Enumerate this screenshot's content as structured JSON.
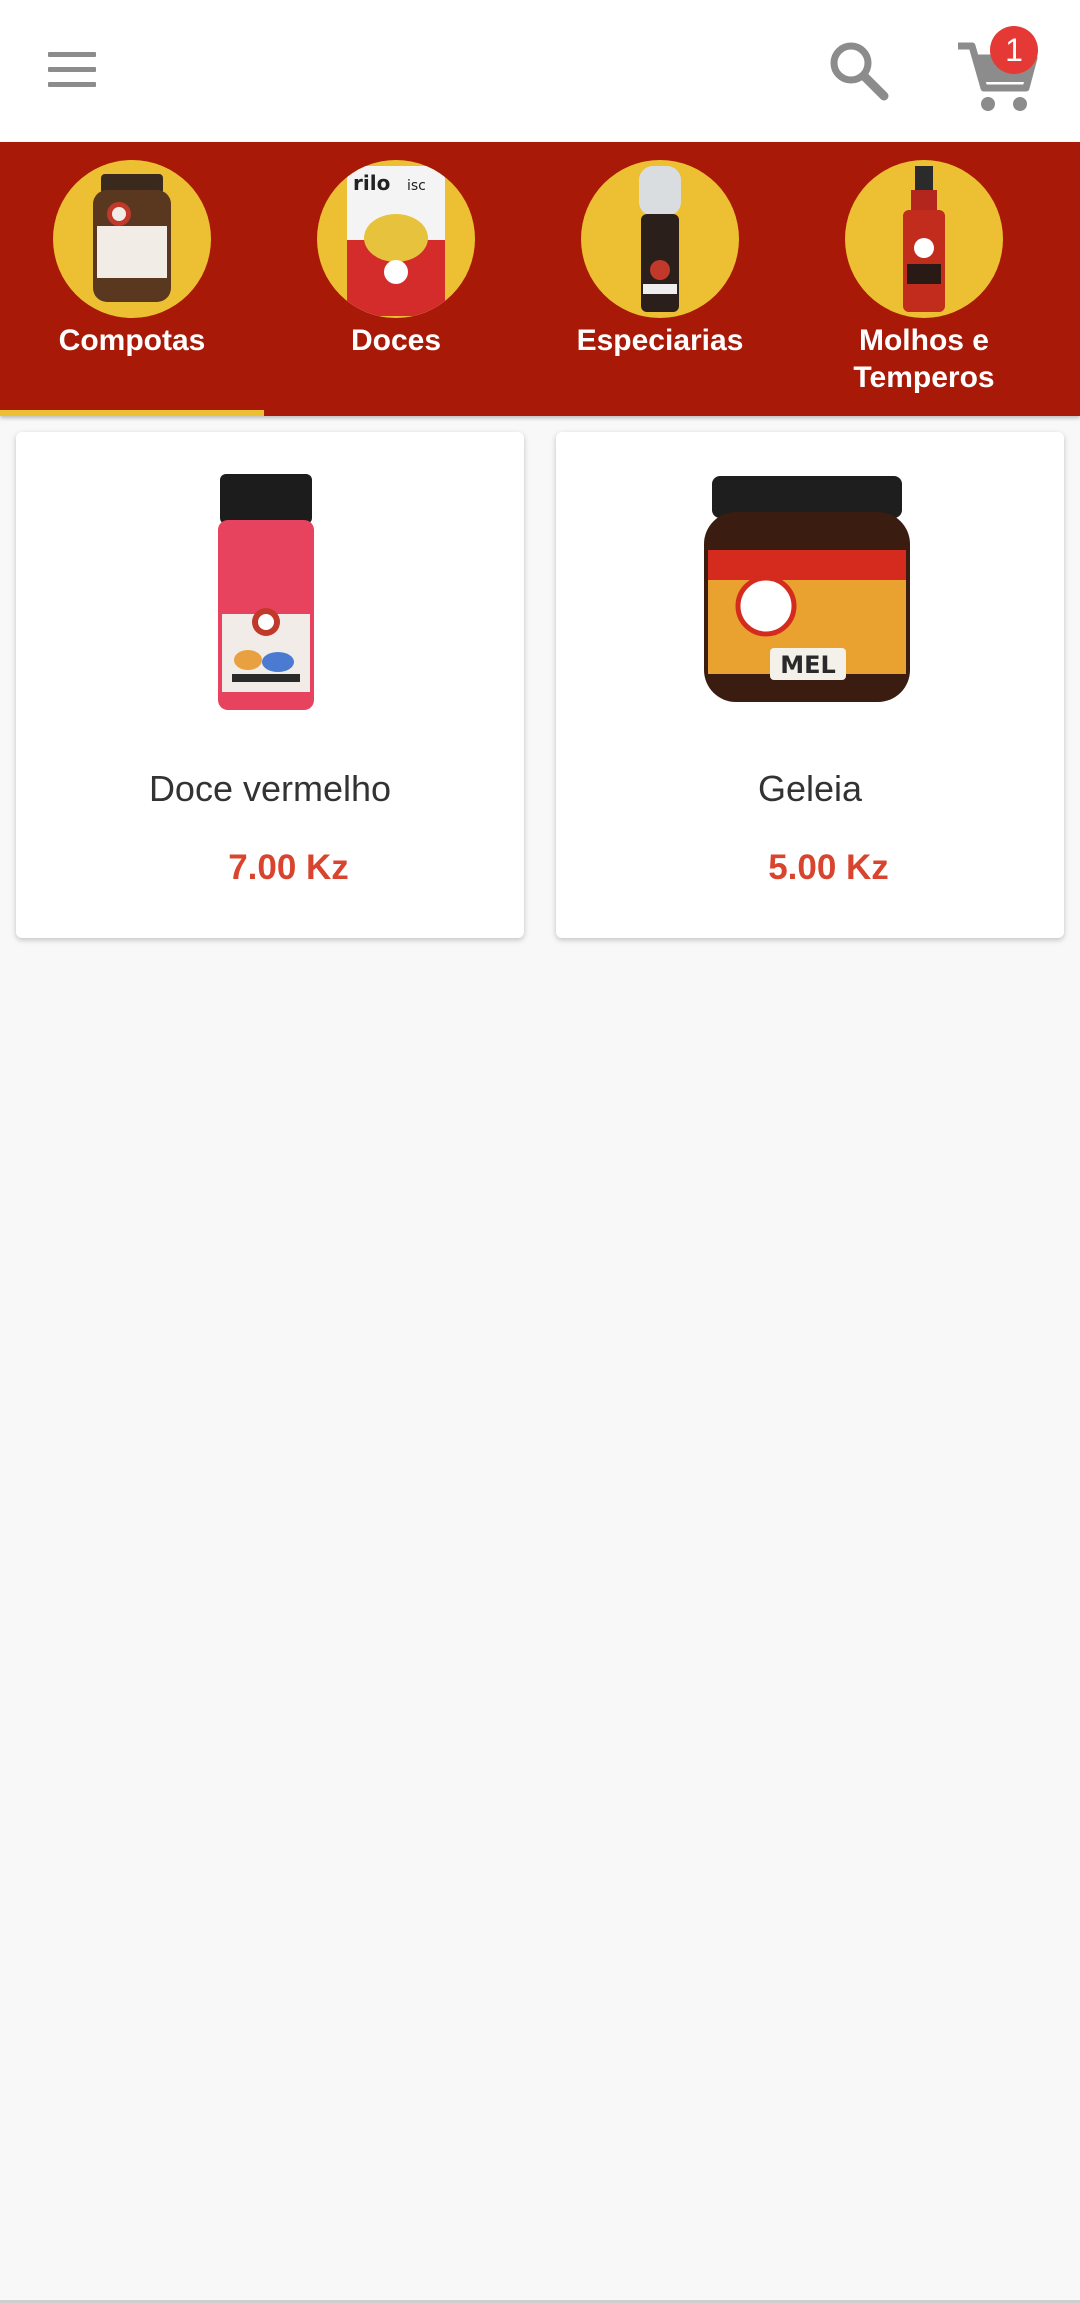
{
  "cart": {
    "badge_count": "1"
  },
  "colors": {
    "header_background": "#ffffff",
    "tabs_background": "#a81a07",
    "accent_yellow": "#edbf33",
    "price_red": "#d9442f",
    "badge_red": "#e53935",
    "icon_gray": "#8c8c8c"
  },
  "icons": {
    "menu": "hamburger-menu-icon",
    "search": "search-icon",
    "cart": "shopping-cart-icon"
  },
  "categories": [
    {
      "label": "Compotas",
      "selected": true
    },
    {
      "label": "Doces",
      "selected": false
    },
    {
      "label": "Especiarias",
      "selected": false
    },
    {
      "label": "Molhos e Temperos",
      "selected": false
    }
  ],
  "products": [
    {
      "name": "Doce vermelho",
      "price": "7.00 Kz"
    },
    {
      "name": "Geleia",
      "price": "5.00 Kz"
    }
  ]
}
